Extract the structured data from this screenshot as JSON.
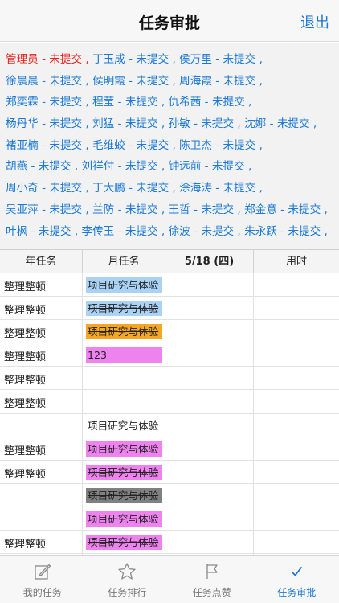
{
  "header": {
    "title": "任务审批",
    "logout_label": "退出"
  },
  "status_lines": [
    {
      "entries": [
        {
          "text": "管理员 - 未提交",
          "admin": true
        },
        {
          "text": "丁玉成 - 未提交"
        },
        {
          "text": "侯万里 - 未提交"
        }
      ]
    },
    {
      "entries": [
        {
          "text": "徐晨晨 - 未提交"
        },
        {
          "text": "侯明霞 - 未提交"
        },
        {
          "text": "周海霞 - 未提交"
        }
      ]
    },
    {
      "entries": [
        {
          "text": "郑奕霖 - 未提交"
        },
        {
          "text": "程莹 - 未提交"
        },
        {
          "text": "仇希茜 - 未提交"
        }
      ]
    },
    {
      "entries": [
        {
          "text": "杨丹华 - 未提交"
        },
        {
          "text": "刘猛 - 未提交"
        },
        {
          "text": "孙敏 - 未提交"
        },
        {
          "text": "沈娜 - 未提交"
        }
      ]
    },
    {
      "entries": [
        {
          "text": "褚亚楠 - 未提交"
        },
        {
          "text": "毛维蛟 - 未提交"
        },
        {
          "text": "陈卫杰 - 未提交"
        }
      ]
    },
    {
      "entries": [
        {
          "text": "胡燕 - 未提交"
        },
        {
          "text": "刘祥付 - 未提交"
        },
        {
          "text": "钟远前 - 未提交"
        }
      ]
    },
    {
      "entries": [
        {
          "text": "周小奇 - 未提交"
        },
        {
          "text": "丁大鹏 - 未提交"
        },
        {
          "text": "涂海涛 - 未提交"
        }
      ]
    },
    {
      "entries": [
        {
          "text": "吴亚萍 - 未提交"
        },
        {
          "text": "兰防 - 未提交"
        },
        {
          "text": "王哲 - 未提交"
        },
        {
          "text": "郑金意 - 未提交"
        }
      ]
    },
    {
      "entries": [
        {
          "text": "叶枫 - 未提交"
        },
        {
          "text": "李传玉 - 未提交"
        },
        {
          "text": "徐波 - 未提交"
        },
        {
          "text": "朱永跃 - 未提交"
        }
      ]
    }
  ],
  "table": {
    "headers": {
      "year": "年任务",
      "month": "月任务",
      "date": "5/18 (四)",
      "hours": "用时"
    },
    "rows": [
      {
        "year": "整理整顿",
        "month": "项目研究与体验",
        "color": "#a9d2f5",
        "struck": true
      },
      {
        "year": "整理整顿",
        "month": "项目研究与体验",
        "color": "#a9d2f5",
        "struck": true
      },
      {
        "year": "整理整顿",
        "month": "项目研究与体验",
        "color": "#f6a623",
        "struck": true
      },
      {
        "year": "整理整顿",
        "month": "123",
        "color": "#ee82ee",
        "struck": true
      },
      {
        "year": "整理整顿",
        "month": "",
        "color": "",
        "struck": false
      },
      {
        "year": "整理整顿",
        "month": "",
        "color": "",
        "struck": false
      },
      {
        "year": "",
        "month": "项目研究与体验",
        "color": "",
        "struck": false
      },
      {
        "year": "整理整顿",
        "month": "项目研究与体验",
        "color": "#ee82ee",
        "struck": true
      },
      {
        "year": "整理整顿",
        "month": "项目研究与体验",
        "color": "#ee82ee",
        "struck": true
      },
      {
        "year": "",
        "month": "项目研究与体验",
        "color": "#808080",
        "struck": true
      },
      {
        "year": "",
        "month": "项目研究与体验",
        "color": "#ee82ee",
        "struck": true
      },
      {
        "year": "整理整顿",
        "month": "项目研究与体验",
        "color": "#ee82ee",
        "struck": true
      },
      {
        "year": "",
        "month": "项目研究与体验",
        "color": "#ee82ee",
        "struck": true
      }
    ]
  },
  "tabs": [
    {
      "label": "我的任务",
      "icon": "edit-icon",
      "active": false
    },
    {
      "label": "任务排行",
      "icon": "star-icon",
      "active": false
    },
    {
      "label": "任务点赞",
      "icon": "flag-icon",
      "active": false
    },
    {
      "label": "任务审批",
      "icon": "check-icon",
      "active": true
    }
  ],
  "colors": {
    "accent": "#1a78d6",
    "admin": "#e8231f"
  }
}
